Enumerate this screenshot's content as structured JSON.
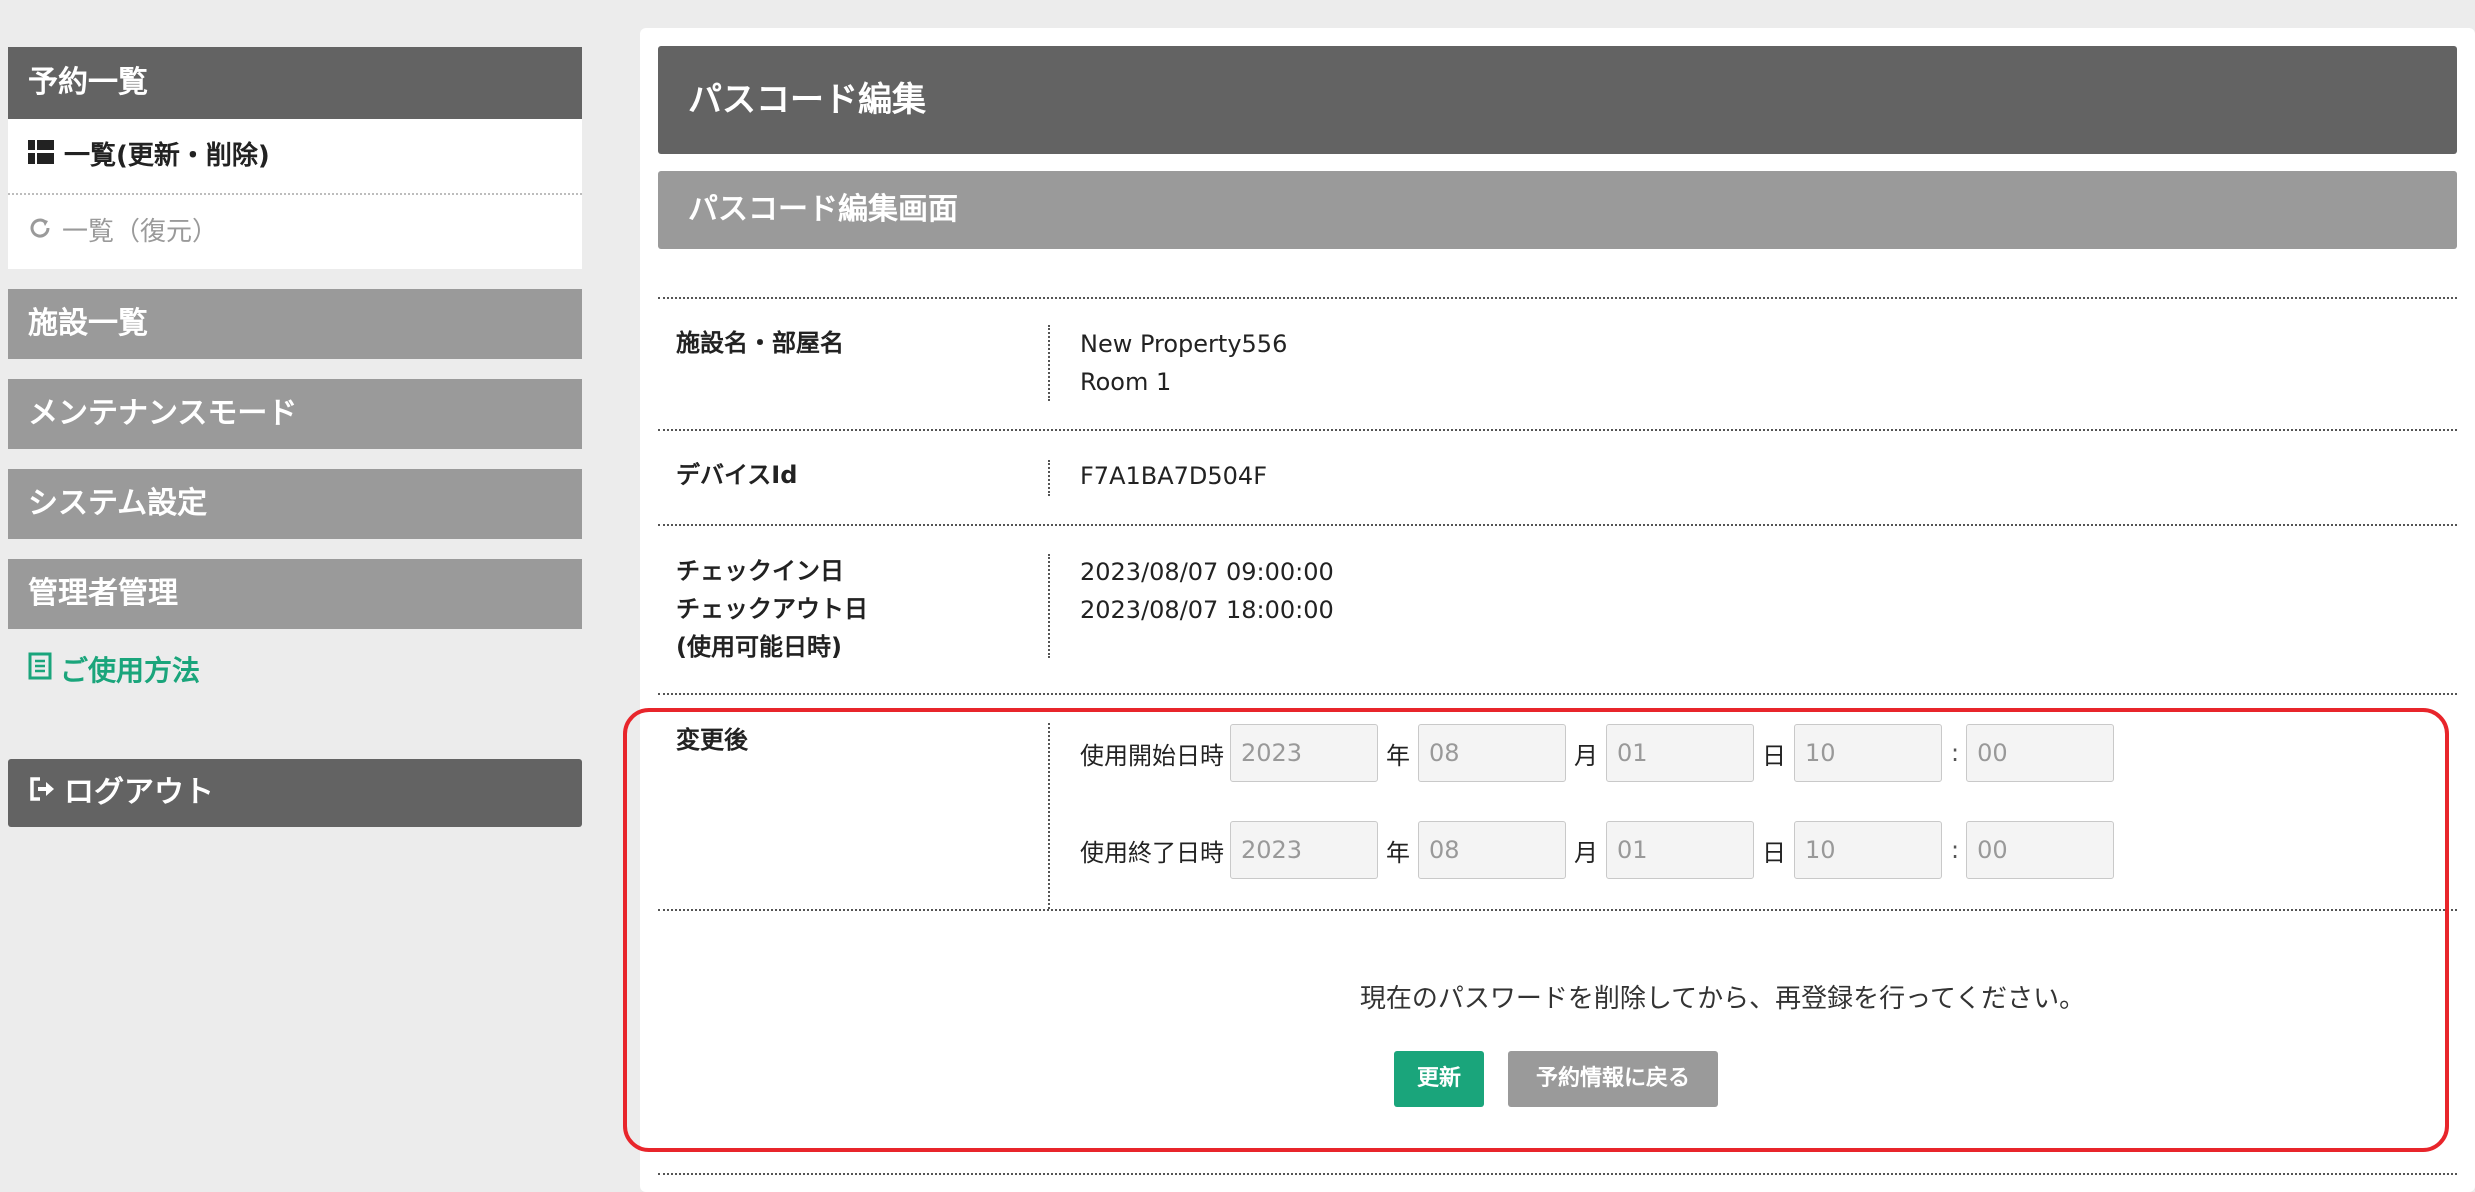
{
  "sidebar": {
    "reservations_header": "予約一覧",
    "items": [
      {
        "label": "一覧(更新・削除)"
      },
      {
        "label": "一覧（復元）"
      }
    ],
    "facilities": "施設一覧",
    "maintenance": "メンテナンスモード",
    "system_settings": "システム設定",
    "admin_management": "管理者管理",
    "usage": "ご使用方法",
    "logout": "ログアウト"
  },
  "main": {
    "title": "パスコード編集",
    "subtitle": "パスコード編集画面",
    "facility_label": "施設名・部屋名",
    "facility_name": "New Property556",
    "room_name": "Room 1",
    "device_label": "デバイスId",
    "device_id": "F7A1BA7D504F",
    "checkin_label": "チェックイン日",
    "checkout_label": "チェックアウト日",
    "usable_label": "(使用可能日時)",
    "checkin_value": "2023/08/07 09:00:00",
    "checkout_value": "2023/08/07 18:00:00",
    "change_label": "変更後",
    "start": {
      "label": "使用開始日時",
      "year": "2023",
      "month": "08",
      "day": "01",
      "hour": "10",
      "minute": "00"
    },
    "end": {
      "label": "使用終了日時",
      "year": "2023",
      "month": "08",
      "day": "01",
      "hour": "10",
      "minute": "00"
    },
    "units": {
      "year": "年",
      "month": "月",
      "day": "日",
      "colon": ":"
    },
    "notice": "現在のパスワードを削除してから、再登録を行ってください。",
    "update_button": "更新",
    "back_button": "予約情報に戻る"
  }
}
